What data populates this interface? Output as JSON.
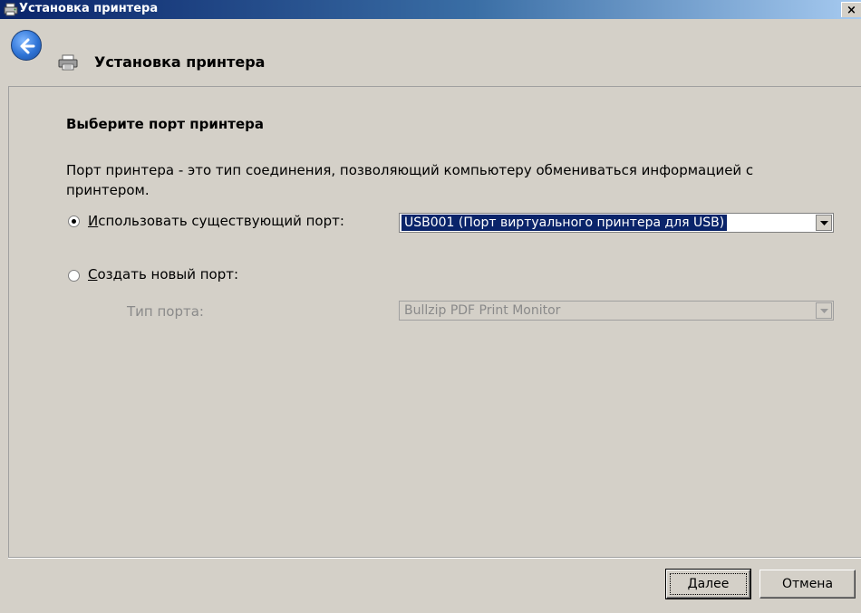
{
  "window": {
    "title": "Установка принтера",
    "close_glyph": "×",
    "title_icon": "printer-wizard-icon"
  },
  "nav": {
    "back_icon": "back-arrow-icon",
    "header_icon": "printer-icon",
    "title": "Установка принтера"
  },
  "main": {
    "heading": "Выберите порт принтера",
    "description": "Порт принтера - это тип соединения, позволяющий компьютеру обмениваться информацией с принтером.",
    "use_existing": {
      "label_underlined": "И",
      "label_rest": "спользовать существующий порт:",
      "selected": true,
      "value": "USB001 (Порт виртуального принтера для USB)"
    },
    "create_new": {
      "label_underlined": "С",
      "label_rest": "оздать новый порт:",
      "selected": false
    },
    "port_type": {
      "label": "Тип порта:",
      "value": "Bullzip PDF Print Monitor",
      "disabled": true
    }
  },
  "footer": {
    "next_underlined": "Д",
    "next_rest": "алее",
    "cancel_label": "Отмена"
  },
  "colors": {
    "face": "#d4d0c8",
    "title_gradient_start": "#0a246a",
    "title_gradient_end": "#a6caf0",
    "selection": "#0a246a",
    "disabled_text": "#8a8a8a"
  }
}
